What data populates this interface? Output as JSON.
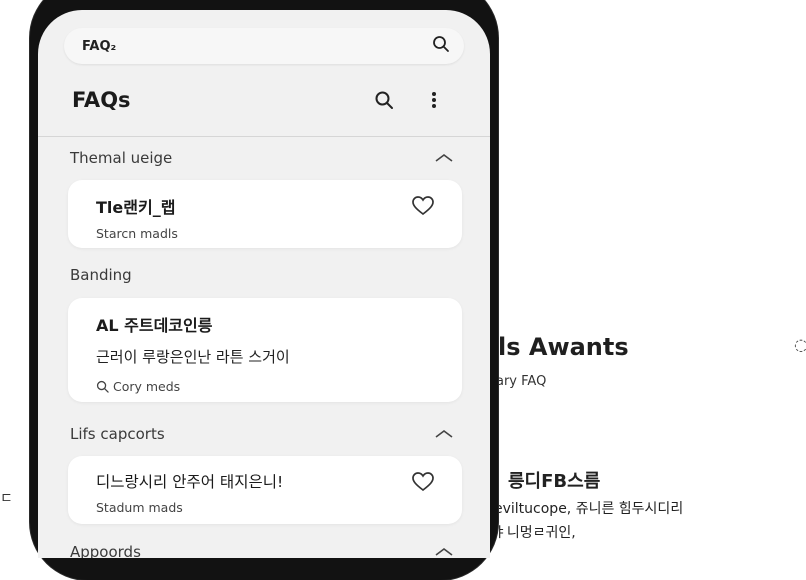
{
  "search_bar": {
    "text": "FAQ₂"
  },
  "header": {
    "title": "FAQs"
  },
  "sections": [
    {
      "label": "Themal ueige",
      "collapse_icon": "chevron-up-icon",
      "card": {
        "title": "Tle랜키_랩",
        "subtitle": "Starcn madls",
        "favorite_icon": "heart-icon"
      }
    },
    {
      "label": "Banding",
      "card": {
        "title": "AL 주트데코인릉",
        "line": "근러이 루랑은인난 라튼 스거이",
        "subtitle": "Cory meds",
        "subtitle_icon": "search-icon"
      }
    },
    {
      "label": "Lifs capcorts",
      "collapse_icon": "chevron-up-icon",
      "card": {
        "title": "디느랑시리 안주어 태지은니!",
        "subtitle": "Stadum mads",
        "favorite_icon": "heart-icon"
      }
    },
    {
      "label": "Appoords",
      "collapse_icon": "chevron-up-icon"
    }
  ],
  "background_screen": {
    "title": "ls Awants",
    "subtitle": "ary FAQ",
    "edge_glyph": "◌",
    "heading": "릉디FB스름",
    "body_line1": "eviltucope, 쥬니른 힘두시디리",
    "body_line2": "ㅑ니멍ㄹ귀인,",
    "left_glyph": "ㄷ"
  },
  "colors": {
    "screen_bg": "#f1f1f1",
    "card_bg": "#ffffff",
    "phone_frame": "#121212",
    "text_primary": "#1b1b1b",
    "text_secondary": "#444444"
  }
}
